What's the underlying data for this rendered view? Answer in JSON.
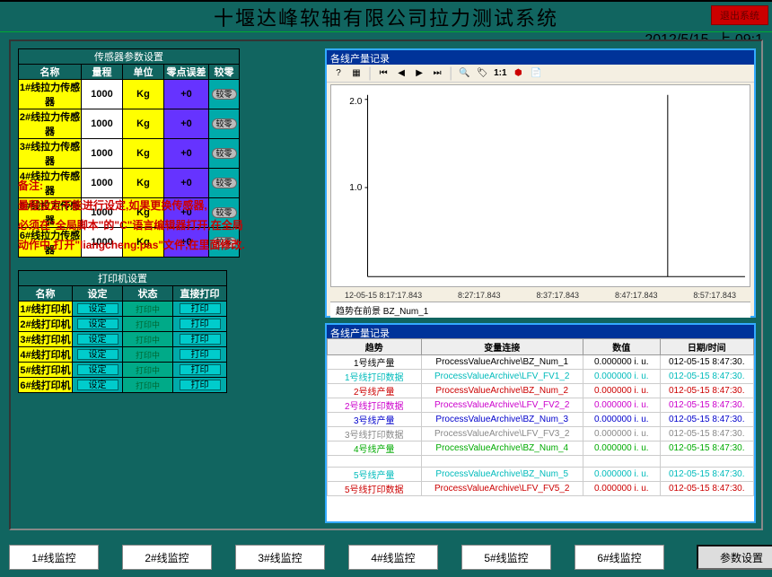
{
  "header": {
    "title": "十堰达峰软轴有限公司拉力测试系统",
    "exit": "退出系统",
    "date": "2012/5/15",
    "time": "09:1"
  },
  "sensor": {
    "caption": "传感器参数设置",
    "cols": [
      "名称",
      "量程",
      "单位",
      "零点误差",
      "较零"
    ],
    "rows": [
      {
        "n": "1#线拉力传感器",
        "r": "1000",
        "u": "Kg",
        "o": "+0"
      },
      {
        "n": "2#线拉力传感器",
        "r": "1000",
        "u": "Kg",
        "o": "+0"
      },
      {
        "n": "3#线拉力传感器",
        "r": "1000",
        "u": "Kg",
        "o": "+0"
      },
      {
        "n": "4#线拉力传感器",
        "r": "1000",
        "u": "Kg",
        "o": "+0"
      },
      {
        "n": "5#线拉力传感器",
        "r": "1000",
        "u": "Kg",
        "o": "+0"
      },
      {
        "n": "6#线拉力传感器",
        "r": "1000",
        "u": "Kg",
        "o": "+0"
      }
    ],
    "zero_btn": "较零"
  },
  "note": {
    "l1": "备注:",
    "l2": "量程设定不能进行设定,如果更换传感器,",
    "l3": "必须在\"全局脚本\"的\"C\"语言编辑器打开,在全局",
    "l4": "动作中,打开\"liangcheng.pas\"文件,在里面修改."
  },
  "printer": {
    "caption": "打印机设置",
    "cols": [
      "名称",
      "设定",
      "状态",
      "直接打印"
    ],
    "rows": [
      {
        "n": "1#线打印机"
      },
      {
        "n": "2#线打印机"
      },
      {
        "n": "3#线打印机"
      },
      {
        "n": "4#线打印机"
      },
      {
        "n": "5#线打印机"
      },
      {
        "n": "6#线打印机"
      }
    ],
    "set_btn": "设定",
    "print_btn": "打印",
    "status": "打印中"
  },
  "chart": {
    "title": "各线产量记录",
    "subtitle": "趋势在前景 BZ_Num_1",
    "ratio": "1:1",
    "xticks": [
      "12-05-15 8:17:17.843",
      "8:27:17.843",
      "8:37:17.843",
      "8:47:17.843",
      "8:57:17.843"
    ]
  },
  "chart_data": {
    "type": "line",
    "title": "各线产量记录",
    "ylabel": "",
    "ylim": [
      0,
      2.0
    ],
    "yticks": [
      1.0,
      2.0
    ],
    "x": [
      "12-05-15 8:17:17.843",
      "8:27:17.843",
      "8:37:17.843",
      "8:47:17.843",
      "8:57:17.843"
    ],
    "series": [
      {
        "name": "BZ_Num_1",
        "values": [
          0,
          0,
          0,
          0,
          0
        ]
      }
    ]
  },
  "datagrid": {
    "title": "各线产量记录",
    "cols": [
      "趋势",
      "变量连接",
      "数值",
      "日期/时间"
    ],
    "rows": [
      {
        "t": "1号线产量",
        "v": "ProcessValueArchive\\BZ_Num_1",
        "val": "0.000000 i. u.",
        "dt": "012-05-15 8:47:30.",
        "c": "#000"
      },
      {
        "t": "1号线打印数据",
        "v": "ProcessValueArchive\\LFV_FV1_2",
        "val": "0.000000 i. u.",
        "dt": "012-05-15 8:47:30.",
        "c": "#0bb"
      },
      {
        "t": "2号线产量",
        "v": "ProcessValueArchive\\BZ_Num_2",
        "val": "0.000000 i. u.",
        "dt": "012-05-15 8:47:30.",
        "c": "#c00"
      },
      {
        "t": "2号线打印数据",
        "v": "ProcessValueArchive\\LFV_FV2_2",
        "val": "0.000000 i. u.",
        "dt": "012-05-15 8:47:30.",
        "c": "#c0c"
      },
      {
        "t": "3号线产量",
        "v": "ProcessValueArchive\\BZ_Num_3",
        "val": "0.000000 i. u.",
        "dt": "012-05-15 8:47:30.",
        "c": "#00c"
      },
      {
        "t": "3号线打印数据",
        "v": "ProcessValueArchive\\LFV_FV3_2",
        "val": "0.000000 i. u.",
        "dt": "012-05-15 8:47:30.",
        "c": "#888"
      },
      {
        "t": "4号线产量",
        "v": "ProcessValueArchive\\BZ_Num_4",
        "val": "0.000000 i. u.",
        "dt": "012-05-15 8:47:30.",
        "c": "#0a0"
      },
      {
        "t": "",
        "v": "",
        "val": "",
        "dt": "",
        "c": "#000"
      },
      {
        "t": "5号线产量",
        "v": "ProcessValueArchive\\BZ_Num_5",
        "val": "0.000000 i. u.",
        "dt": "012-05-15 8:47:30.",
        "c": "#0bb"
      },
      {
        "t": "5号线打印数据",
        "v": "ProcessValueArchive\\LFV_FV5_2",
        "val": "0.000000 i. u.",
        "dt": "012-05-15 8:47:30.",
        "c": "#c00"
      }
    ]
  },
  "nav": {
    "buttons": [
      "1#线监控",
      "2#线监控",
      "3#线监控",
      "4#线监控",
      "5#线监控",
      "6#线监控"
    ],
    "settings": "参数设置"
  }
}
